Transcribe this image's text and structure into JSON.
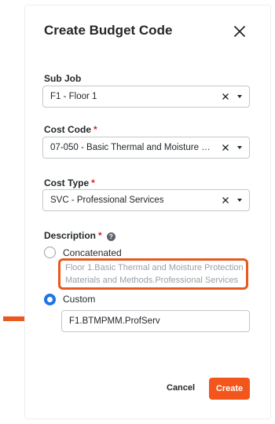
{
  "dialog": {
    "title": "Create Budget Code",
    "close_icon": "close-icon"
  },
  "fields": {
    "sub_job": {
      "label": "Sub Job",
      "required": false,
      "value": "F1 - Floor 1"
    },
    "cost_code": {
      "label": "Cost Code",
      "required": true,
      "required_mark": "*",
      "value": "07-050 - Basic Thermal and Moisture Pr..."
    },
    "cost_type": {
      "label": "Cost Type",
      "required": true,
      "required_mark": "*",
      "value": "SVC - Professional Services"
    }
  },
  "description": {
    "label": "Description",
    "required_mark": "*",
    "help_icon": "help-icon",
    "help_glyph": "?",
    "options": {
      "concatenated": {
        "label": "Concatenated",
        "selected": false,
        "preview": "Floor 1.Basic Thermal and Moisture Protection Materials and Methods.Professional Services"
      },
      "custom": {
        "label": "Custom",
        "selected": true,
        "value": "F1.BTMPMM.ProfServ"
      }
    }
  },
  "footer": {
    "cancel_label": "Cancel",
    "create_label": "Create"
  },
  "colors": {
    "accent": "#f2561d",
    "annotation": "#e8591f",
    "radio_selected": "#1d73e8",
    "required": "#e01f1f"
  }
}
